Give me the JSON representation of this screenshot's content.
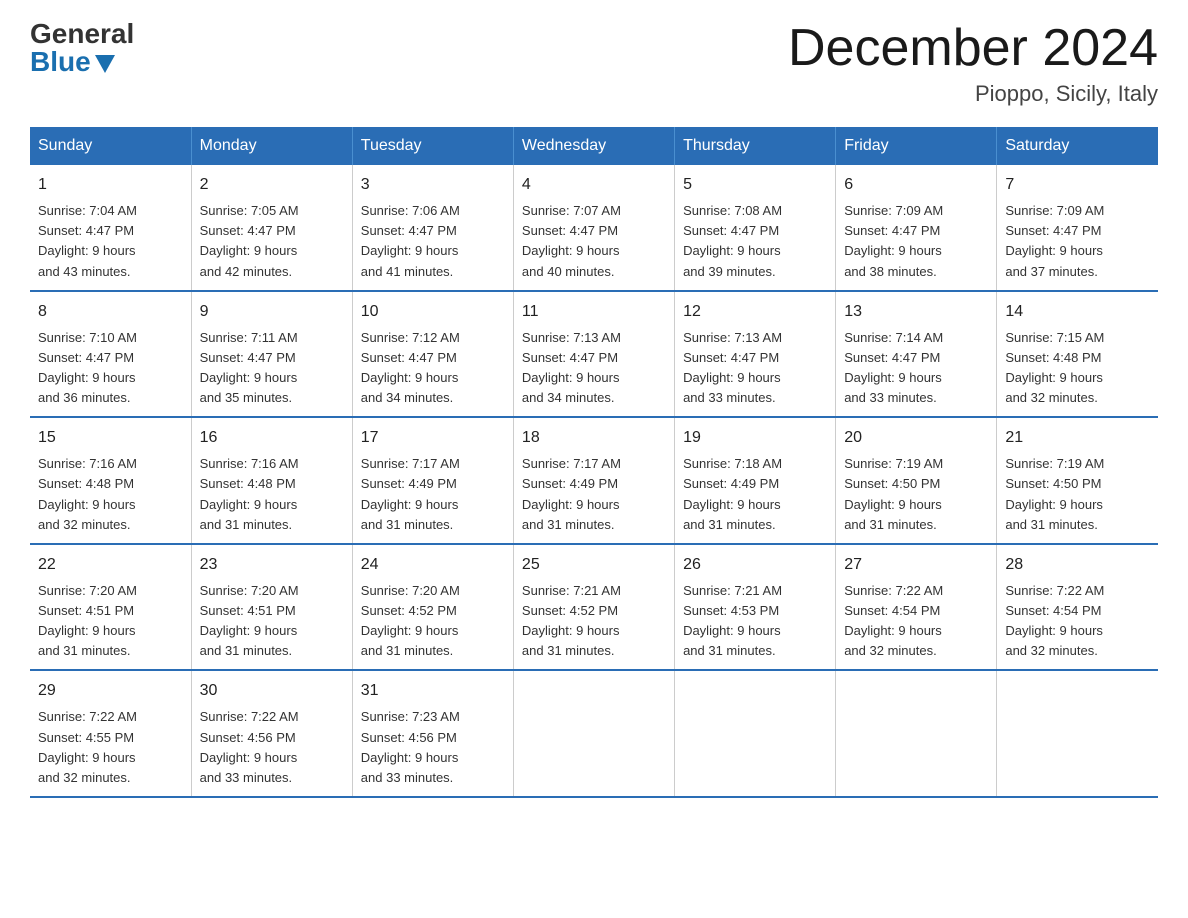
{
  "logo": {
    "general": "General",
    "blue": "Blue"
  },
  "title": "December 2024",
  "location": "Pioppo, Sicily, Italy",
  "days_of_week": [
    "Sunday",
    "Monday",
    "Tuesday",
    "Wednesday",
    "Thursday",
    "Friday",
    "Saturday"
  ],
  "weeks": [
    [
      {
        "day": "1",
        "sunrise": "7:04 AM",
        "sunset": "4:47 PM",
        "daylight": "9 hours and 43 minutes."
      },
      {
        "day": "2",
        "sunrise": "7:05 AM",
        "sunset": "4:47 PM",
        "daylight": "9 hours and 42 minutes."
      },
      {
        "day": "3",
        "sunrise": "7:06 AM",
        "sunset": "4:47 PM",
        "daylight": "9 hours and 41 minutes."
      },
      {
        "day": "4",
        "sunrise": "7:07 AM",
        "sunset": "4:47 PM",
        "daylight": "9 hours and 40 minutes."
      },
      {
        "day": "5",
        "sunrise": "7:08 AM",
        "sunset": "4:47 PM",
        "daylight": "9 hours and 39 minutes."
      },
      {
        "day": "6",
        "sunrise": "7:09 AM",
        "sunset": "4:47 PM",
        "daylight": "9 hours and 38 minutes."
      },
      {
        "day": "7",
        "sunrise": "7:09 AM",
        "sunset": "4:47 PM",
        "daylight": "9 hours and 37 minutes."
      }
    ],
    [
      {
        "day": "8",
        "sunrise": "7:10 AM",
        "sunset": "4:47 PM",
        "daylight": "9 hours and 36 minutes."
      },
      {
        "day": "9",
        "sunrise": "7:11 AM",
        "sunset": "4:47 PM",
        "daylight": "9 hours and 35 minutes."
      },
      {
        "day": "10",
        "sunrise": "7:12 AM",
        "sunset": "4:47 PM",
        "daylight": "9 hours and 34 minutes."
      },
      {
        "day": "11",
        "sunrise": "7:13 AM",
        "sunset": "4:47 PM",
        "daylight": "9 hours and 34 minutes."
      },
      {
        "day": "12",
        "sunrise": "7:13 AM",
        "sunset": "4:47 PM",
        "daylight": "9 hours and 33 minutes."
      },
      {
        "day": "13",
        "sunrise": "7:14 AM",
        "sunset": "4:47 PM",
        "daylight": "9 hours and 33 minutes."
      },
      {
        "day": "14",
        "sunrise": "7:15 AM",
        "sunset": "4:48 PM",
        "daylight": "9 hours and 32 minutes."
      }
    ],
    [
      {
        "day": "15",
        "sunrise": "7:16 AM",
        "sunset": "4:48 PM",
        "daylight": "9 hours and 32 minutes."
      },
      {
        "day": "16",
        "sunrise": "7:16 AM",
        "sunset": "4:48 PM",
        "daylight": "9 hours and 31 minutes."
      },
      {
        "day": "17",
        "sunrise": "7:17 AM",
        "sunset": "4:49 PM",
        "daylight": "9 hours and 31 minutes."
      },
      {
        "day": "18",
        "sunrise": "7:17 AM",
        "sunset": "4:49 PM",
        "daylight": "9 hours and 31 minutes."
      },
      {
        "day": "19",
        "sunrise": "7:18 AM",
        "sunset": "4:49 PM",
        "daylight": "9 hours and 31 minutes."
      },
      {
        "day": "20",
        "sunrise": "7:19 AM",
        "sunset": "4:50 PM",
        "daylight": "9 hours and 31 minutes."
      },
      {
        "day": "21",
        "sunrise": "7:19 AM",
        "sunset": "4:50 PM",
        "daylight": "9 hours and 31 minutes."
      }
    ],
    [
      {
        "day": "22",
        "sunrise": "7:20 AM",
        "sunset": "4:51 PM",
        "daylight": "9 hours and 31 minutes."
      },
      {
        "day": "23",
        "sunrise": "7:20 AM",
        "sunset": "4:51 PM",
        "daylight": "9 hours and 31 minutes."
      },
      {
        "day": "24",
        "sunrise": "7:20 AM",
        "sunset": "4:52 PM",
        "daylight": "9 hours and 31 minutes."
      },
      {
        "day": "25",
        "sunrise": "7:21 AM",
        "sunset": "4:52 PM",
        "daylight": "9 hours and 31 minutes."
      },
      {
        "day": "26",
        "sunrise": "7:21 AM",
        "sunset": "4:53 PM",
        "daylight": "9 hours and 31 minutes."
      },
      {
        "day": "27",
        "sunrise": "7:22 AM",
        "sunset": "4:54 PM",
        "daylight": "9 hours and 32 minutes."
      },
      {
        "day": "28",
        "sunrise": "7:22 AM",
        "sunset": "4:54 PM",
        "daylight": "9 hours and 32 minutes."
      }
    ],
    [
      {
        "day": "29",
        "sunrise": "7:22 AM",
        "sunset": "4:55 PM",
        "daylight": "9 hours and 32 minutes."
      },
      {
        "day": "30",
        "sunrise": "7:22 AM",
        "sunset": "4:56 PM",
        "daylight": "9 hours and 33 minutes."
      },
      {
        "day": "31",
        "sunrise": "7:23 AM",
        "sunset": "4:56 PM",
        "daylight": "9 hours and 33 minutes."
      },
      {
        "day": "",
        "sunrise": "",
        "sunset": "",
        "daylight": ""
      },
      {
        "day": "",
        "sunrise": "",
        "sunset": "",
        "daylight": ""
      },
      {
        "day": "",
        "sunrise": "",
        "sunset": "",
        "daylight": ""
      },
      {
        "day": "",
        "sunrise": "",
        "sunset": "",
        "daylight": ""
      }
    ]
  ],
  "labels": {
    "sunrise": "Sunrise:",
    "sunset": "Sunset:",
    "daylight": "Daylight:"
  }
}
